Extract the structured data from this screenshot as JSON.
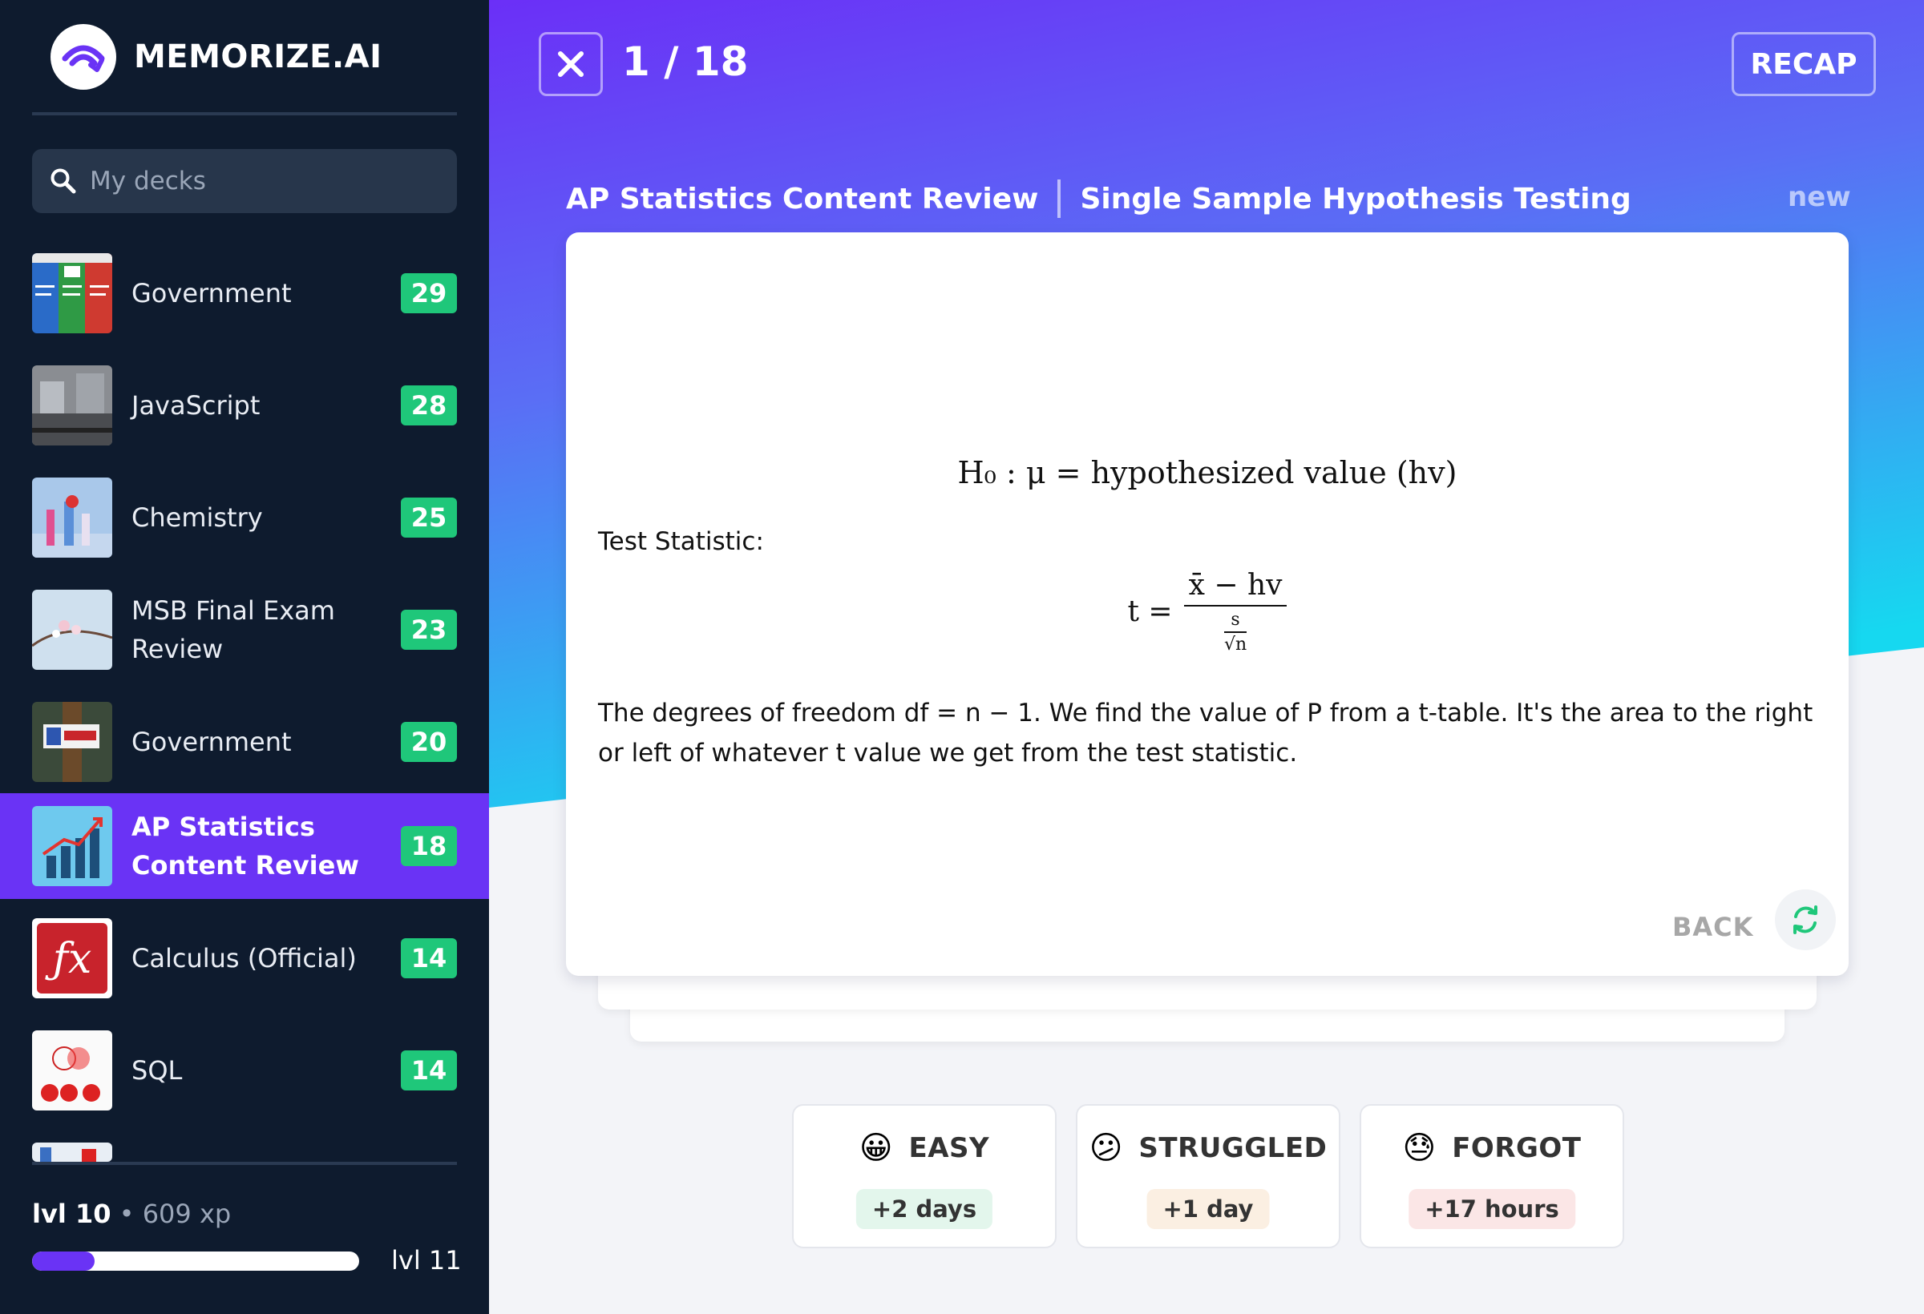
{
  "app": {
    "brand": "MEMORIZE.AI"
  },
  "sidebar": {
    "search_placeholder": "My decks",
    "decks": [
      {
        "name": "Government",
        "count": "29",
        "active": false
      },
      {
        "name": "JavaScript",
        "count": "28",
        "active": false
      },
      {
        "name": "Chemistry",
        "count": "25",
        "active": false
      },
      {
        "name": "MSB Final Exam Review",
        "count": "23",
        "active": false
      },
      {
        "name": "Government",
        "count": "20",
        "active": false
      },
      {
        "name": "AP Statistics Content Review",
        "count": "18",
        "active": true
      },
      {
        "name": "Calculus (Official)",
        "count": "14",
        "active": false
      },
      {
        "name": "SQL",
        "count": "14",
        "active": false
      }
    ],
    "level": {
      "current": "lvl 10",
      "separator": "•",
      "xp": "609 xp",
      "next": "lvl 11",
      "progress_fraction": 0.19
    }
  },
  "session": {
    "progress_label": "1 / 18",
    "recap_label": "RECAP",
    "breadcrumb": {
      "deck": "AP Statistics Content Review",
      "topic": "Single Sample Hypothesis Testing"
    },
    "card_status": "new"
  },
  "card": {
    "null_hypothesis": "H₀ : μ = hypothesized value (hv)",
    "test_statistic_label": "Test Statistic:",
    "formula": {
      "lhs": "t =",
      "numerator": "x̄ − hv",
      "den_s": "s",
      "den_sqrt": "√n"
    },
    "explanation": "The degrees of freedom df = n − 1. We find the value of P from a t-table. It's the area to the right or left of whatever t value we get from the test statistic.",
    "back_label": "BACK"
  },
  "rating": {
    "options": [
      {
        "label": "EASY",
        "interval": "+2 days",
        "emoji": "😀",
        "pill_color": "#e3f6ec"
      },
      {
        "label": "STRUGGLED",
        "interval": "+1 day",
        "emoji": "😕",
        "pill_color": "#fbefe2"
      },
      {
        "label": "FORGOT",
        "interval": "+17 hours",
        "emoji": "😓",
        "pill_color": "#fbe6e6"
      }
    ]
  },
  "colors": {
    "sidebar_bg": "#0e1b2e",
    "accent_purple": "#6a33f5",
    "badge_green": "#1fc77a",
    "gradient_top": "#6b2ff7",
    "gradient_bottom": "#16d8f0"
  }
}
